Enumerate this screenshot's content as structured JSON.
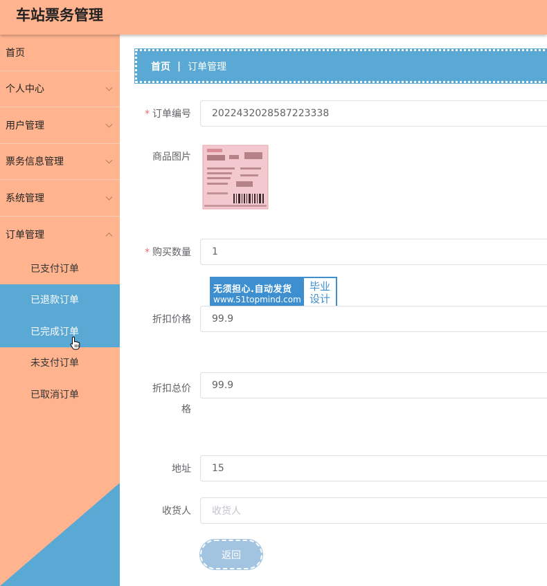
{
  "header": {
    "title": "车站票务管理"
  },
  "sidebar": {
    "items": [
      {
        "label": "首页"
      },
      {
        "label": "个人中心"
      },
      {
        "label": "用户管理"
      },
      {
        "label": "票务信息管理"
      },
      {
        "label": "系统管理"
      },
      {
        "label": "订单管理"
      }
    ],
    "subitems": [
      {
        "label": "已支付订单"
      },
      {
        "label": "已退款订单"
      },
      {
        "label": "已完成订单"
      },
      {
        "label": "未支付订单"
      },
      {
        "label": "已取消订单"
      }
    ]
  },
  "breadcrumb": {
    "home": "首页",
    "separator": "|",
    "current": "订单管理"
  },
  "form": {
    "order_no": {
      "label": "订单编号",
      "value": "2022432028587223338"
    },
    "product_image": {
      "label": "商品图片"
    },
    "quantity": {
      "label": "购买数量",
      "value": "1"
    },
    "discount_price": {
      "label": "折扣价格",
      "value": "99.9"
    },
    "discount_total": {
      "label_line1": "折扣总价",
      "label_line2": "格",
      "value": "99.9"
    },
    "address": {
      "label": "地址",
      "value": "15"
    },
    "receiver": {
      "label": "收货人",
      "placeholder": "收货人"
    },
    "back_label": "返回"
  },
  "required_mark": "*",
  "watermark": {
    "slogan": "无须担心.自动发货",
    "site": "www.51topmind.com",
    "tag_line1": "毕业",
    "tag_line2": "设计"
  },
  "colors": {
    "sidebar_bg": "#ffb48f",
    "accent_blue": "#5aa8d4",
    "button_bg": "#a3c4e0",
    "required": "#f56c6c"
  }
}
